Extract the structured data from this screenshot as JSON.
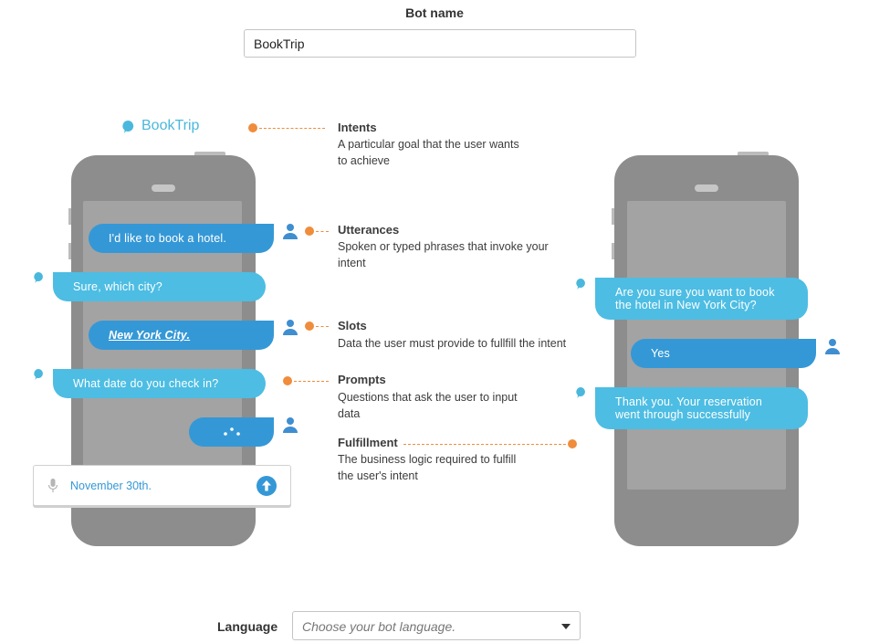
{
  "bot_name": {
    "label": "Bot name",
    "value": "BookTrip"
  },
  "brand": {
    "name": "BookTrip"
  },
  "left_phone": {
    "messages": [
      {
        "role": "user",
        "text": "I'd like to book a hotel."
      },
      {
        "role": "bot",
        "text": "Sure, which city?"
      },
      {
        "role": "user",
        "text": "New York City."
      },
      {
        "role": "bot",
        "text": "What date do you check in?"
      },
      {
        "role": "user",
        "text": "• • •"
      }
    ],
    "input": {
      "value": "November 30th.",
      "mic_icon": "microphone-icon",
      "send_icon": "send-arrow-icon"
    }
  },
  "annotations": [
    {
      "title": "Intents",
      "desc_line1": "A particular goal that the user wants",
      "desc_line2": "to achieve"
    },
    {
      "title": "Utterances",
      "desc_line1": "Spoken or typed phrases that invoke your",
      "desc_line2": "intent"
    },
    {
      "title": "Slots",
      "desc_line1": "Data the user must provide to fullfill the intent",
      "desc_line2": ""
    },
    {
      "title": "Prompts",
      "desc_line1": "Questions that ask the user to input",
      "desc_line2": "data"
    },
    {
      "title": "Fulfillment",
      "desc_line1": "The business logic required to fulfill",
      "desc_line2": "the user's intent"
    }
  ],
  "right_phone": {
    "messages": [
      {
        "role": "bot",
        "line1": "Are you sure you want to book",
        "line2": "the hotel in New York City?"
      },
      {
        "role": "user",
        "text": "Yes"
      },
      {
        "role": "bot",
        "line1": "Thank you. Your reservation",
        "line2": "went through successfully"
      }
    ]
  },
  "language": {
    "label": "Language",
    "placeholder": "Choose your bot language."
  },
  "colors": {
    "bot_bubble": "#4dbde3",
    "user_bubble": "#3598d6",
    "accent_dot": "#ef8d3c",
    "phone_body": "#8d8d8d"
  }
}
